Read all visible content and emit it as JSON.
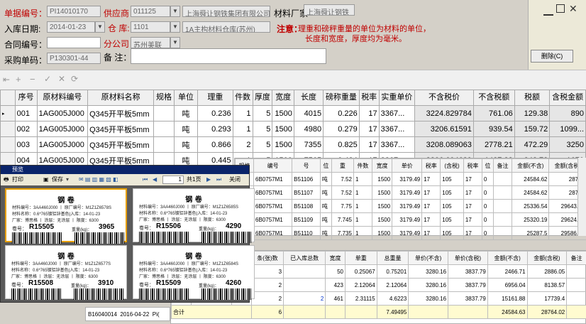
{
  "form": {
    "doc_no_label": "单据编号：",
    "doc_no_value": "PI14010170",
    "supplier_label": "供应商：",
    "supplier_code": "011125",
    "supplier_name": "上海舜让钢铁集团有限公司",
    "mfr_label": "材料厂家",
    "mfr_value": "上海舜让钢铁",
    "date_label": "入库日期:",
    "date_value": "2014-01-23",
    "warehouse_label": "仓 库:",
    "warehouse_code": "1101",
    "warehouse_name": "1A主构材料仓库(苏州)",
    "note_label": "注意：",
    "note_line1": "理重和磅秤重量的单位为材料的单位，",
    "note_line2": "长度和宽度，厚度均为毫米。",
    "contract_label": "合同编号：",
    "contract_value": "",
    "branch_label": "分公司：",
    "branch_value": "苏州美联",
    "purchase_label": "采购单码：",
    "purchase_value": "P130301-44",
    "remark_label": "备 注：",
    "remark_value": ""
  },
  "window": {
    "delete_button": "删除(C)"
  },
  "main_table": {
    "headers": [
      "序号",
      "原材料编号",
      "原材料名称",
      "规格",
      "单位",
      "理重",
      "件数",
      "厚度",
      "宽度",
      "长度",
      "磅称重量",
      "税率",
      "实重单价",
      "不含税价",
      "不含税额",
      "税额",
      "含税金额"
    ],
    "rows": [
      [
        "001",
        "1AG005J000",
        "Q345开平板5mm",
        "",
        "吨",
        "0.236",
        "1",
        "5",
        "1500",
        "4015",
        "0.226",
        "17",
        "3367...",
        "3224.829784",
        "761.06",
        "129.38",
        "890"
      ],
      [
        "002",
        "1AG005J000",
        "Q345开平板5mm",
        "",
        "吨",
        "0.293",
        "1",
        "5",
        "1500",
        "4980",
        "0.279",
        "17",
        "3367...",
        "3206.61591",
        "939.54",
        "159.72",
        "1099..."
      ],
      [
        "003",
        "1AG005J000",
        "Q345开平板5mm",
        "",
        "吨",
        "0.866",
        "2",
        "5",
        "1500",
        "7355",
        "0.825",
        "17",
        "3367...",
        "3208.089063",
        "2778.21",
        "472.29",
        "3250"
      ],
      [
        "004",
        "1AG005J000",
        "Q345开平板5mm",
        "",
        "吨",
        "0.445",
        "1",
        "5",
        "1500",
        "7565",
        "0.424",
        "17",
        "3367...",
        "3206.604629",
        "1427.83",
        "242.73",
        "1670"
      ]
    ]
  },
  "mid_table": {
    "headers": [
      "规格",
      "编号",
      "号",
      "位",
      "重",
      "件数",
      "宽度",
      "单价",
      "税率",
      "(含税)",
      "税率",
      "位",
      "备注",
      "金额(不含)",
      "金额(含税)"
    ],
    "rows": [
      [
        "C",
        "6B0757M1",
        "B51106",
        "吨",
        "7.52",
        "1",
        "1500",
        "3179.49",
        "17",
        "105",
        "17",
        "0",
        "",
        "24584.62",
        "28764"
      ],
      [
        "C",
        "6B0757M1",
        "B51107",
        "吨",
        "7.52",
        "1",
        "1500",
        "3179.49",
        "17",
        "105",
        "17",
        "0",
        "",
        "24584.62",
        "28764"
      ],
      [
        "C",
        "6B0757M1",
        "B51108",
        "吨",
        "7.75",
        "1",
        "1500",
        "3179.49",
        "17",
        "105",
        "17",
        "0",
        "",
        "25336.54",
        "29643.75"
      ],
      [
        "C",
        "6B0757M1",
        "B51109",
        "吨",
        "7.745",
        "1",
        "1500",
        "3179.49",
        "17",
        "105",
        "17",
        "0",
        "",
        "25320.19",
        "29624.62"
      ],
      [
        "C",
        "6B0757M1",
        "B51110",
        "吨",
        "7.735",
        "1",
        "1500",
        "3179.49",
        "17",
        "105",
        "17",
        "0",
        "",
        "25287.5",
        "29586.37"
      ]
    ]
  },
  "bottom_table": {
    "headers": [
      "规格",
      "原厂编号",
      "单位",
      "条(张)数",
      "已入库总数",
      "宽度",
      "单重",
      "总重量",
      "单价(不含)",
      "单价(含税)",
      "金额(不含)",
      "金额(含税)",
      "备注"
    ],
    "rows": [
      [
        "",
        "6B0757M2",
        "吨",
        "3",
        "",
        "50",
        "0.25067",
        "0.75201",
        "3280.16",
        "3837.79",
        "2466.71",
        "2886.05",
        ""
      ],
      [
        "",
        "6B0757M2",
        "吨",
        "2",
        "",
        "423",
        "2.12064",
        "2.12064",
        "3280.16",
        "3837.79",
        "6956.04",
        "8138.57",
        ""
      ],
      [
        "",
        "6B0757M2",
        "吨",
        "2",
        "2",
        "461",
        "2.31115",
        "4.6223",
        "3280.16",
        "3837.79",
        "15161.88",
        "17739.4",
        ""
      ]
    ],
    "total_label": "合计",
    "total_row": [
      "6",
      "",
      "",
      "",
      "7.49495",
      "",
      "",
      "24584.63",
      "28764.02"
    ],
    "left_doc": [
      "B16040014",
      "2016-04-22",
      "Pi("
    ]
  },
  "preview": {
    "title": "预览",
    "toolbar": {
      "print": "打印",
      "save": "保存",
      "page_input": "1",
      "total_pages": "共1页",
      "close": "关闭"
    },
    "card_title": "钢 卷",
    "cards": [
      {
        "line1": "材料编号：3AA460J000 丨 原厂编号：M1Z1Z6578S",
        "line2": "材料名称：0.6*765镀铝锌基色|入库：14-01-23",
        "line3": "厂家：博思格 丨 涂层：无涂层 丨 限度：6300",
        "no_label": "卷号：",
        "no": "R15505",
        "w_label": "重量(kg)：",
        "w": "3965"
      },
      {
        "line1": "材料编号：3AA460J000 丨 原厂编号：M1Z1Z6585S",
        "line2": "材料名称：0.6*765镀铝锌基色|入库：14-01-23",
        "line3": "厂家：博思格 丨 涂层：无涂层 丨 限度：6300",
        "no_label": "卷号：",
        "no": "R15506",
        "w_label": "重量(kg)：",
        "w": "4290"
      },
      {
        "line1": "材料编号：3AA460J000 丨 原厂编号：M1Z1Z6577S",
        "line2": "材料名称：0.6*765镀铝锌基色|入库：14-01-23",
        "line3": "厂家：博思格 丨 涂层：无涂层 丨 限度：6300",
        "no_label": "卷号：",
        "no": "R15508",
        "w_label": "重量(kg)：",
        "w": "3910"
      },
      {
        "line1": "材料编号：3AA460J000 丨 原厂编号：M1Z1Z6584S",
        "line2": "材料名称：0.6*765镀铝锌基色|入库：14-01-23",
        "line3": "厂家：博思格 丨 涂层：无涂层 丨 限度：6300",
        "no_label": "卷号：",
        "no": "R15509",
        "w_label": "重量(kg)：",
        "w": "4260"
      }
    ]
  },
  "colors": {
    "label_red": "#c00000",
    "form_bg": "#d4d0c8",
    "preview_bg": "#5a5a5a",
    "preview_title_bg": "#0a246a"
  }
}
